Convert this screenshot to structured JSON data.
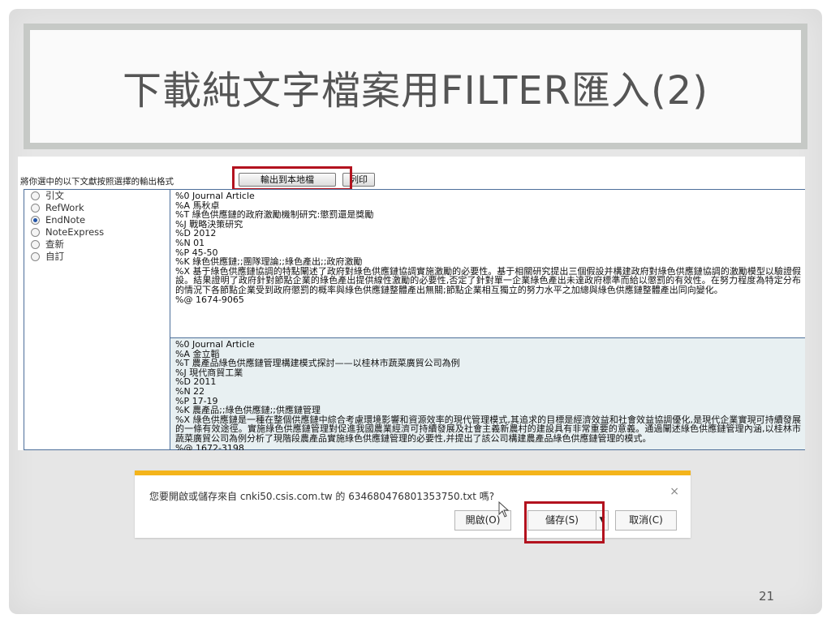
{
  "slide": {
    "title": "下載純文字檔案用FILTER匯入(2)",
    "page_number": "21"
  },
  "export": {
    "prompt": "將你選中的以下文獻按照選擇的輸出格式",
    "export_button": "輸出到本地檔",
    "print_button": "列印",
    "formats": [
      {
        "label": "引文",
        "selected": false
      },
      {
        "label": "RefWork",
        "selected": false
      },
      {
        "label": "EndNote",
        "selected": true
      },
      {
        "label": "NoteExpress",
        "selected": false
      },
      {
        "label": "查新",
        "selected": false
      },
      {
        "label": "自訂",
        "selected": false
      }
    ],
    "records": [
      {
        "lines": [
          "%0 Journal Article",
          "%A 馬秋卓",
          "%T 綠色供應鏈的政府激勵機制研究:懲罰還是獎勵",
          "%J 戰略決策研究",
          "%D 2012",
          "%N 01",
          "%P 45-50",
          "%K 綠色供應鏈;;團隊理論;;綠色產出;;政府激勵"
        ],
        "abstract": "%X 基于綠色供應鏈協調的特點闡述了政府對綠色供應鏈協調實施激勵的必要性。基于相關研究提出三個假設并構建政府對綠色供應鏈協調的激勵模型以驗證假設。結果證明了政府針對節點企業的綠色產出提供線性激勵的必要性,否定了針對單一企業綠色產出未達政府標準而給以懲罰的有效性。在努力程度為特定分布的情況下各節點企業受到政府懲罰的概率與綠色供應鏈整體產出無關;節點企業相互獨立的努力水平之加總與綠色供應鏈整體產出同向變化。",
        "isbn": "%@ 1674-9065"
      },
      {
        "lines": [
          "%0 Journal Article",
          "%A 金立韜",
          "%T 農產品綠色供應鏈管理構建模式探討——以桂林市蔬菜廣貿公司為例",
          "%J 現代商貿工業",
          "%D 2011",
          "%N 22",
          "%P 17-19",
          "%K 農產品;;綠色供應鏈;;供應鏈管理"
        ],
        "abstract": "%X 綠色供應鏈是一種在整個供應鏈中綜合考慮環境影響和資源效率的現代管理模式,其追求的目標是經濟效益和社會效益協調優化,是現代企業實現可持續發展的一條有效途徑。實施綠色供應鏈管理對促進我國農業經濟可持續發展及社會主義新農村的建設具有非常重要的意義。通過闡述綠色供應鏈管理內涵,以桂林市蔬菜廣貿公司為例分析了現階段農產品實施綠色供應鏈管理的必要性,并提出了該公司構建農產品綠色供應鏈管理的模式。",
        "isbn": "%@ 1672-3198"
      }
    ]
  },
  "download_bar": {
    "message": "您要開啟或儲存來自 cnki50.csis.com.tw 的 634680476801353750.txt 嗎?",
    "open_button": "開啟(O)",
    "save_button": "儲存(S)",
    "cancel_button": "取消(C)",
    "close_glyph": "×",
    "dropdown_glyph": "▼"
  },
  "colors": {
    "highlight": "#b3121e",
    "download_bar_accent": "#f4b41b",
    "frame_border": "#4d6f9a"
  }
}
